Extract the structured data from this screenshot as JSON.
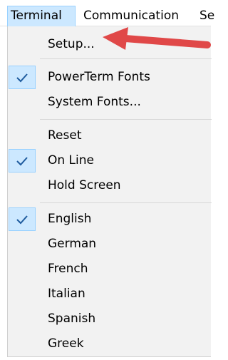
{
  "menubar": {
    "items": [
      {
        "label": "Terminal"
      },
      {
        "label": "Communication"
      },
      {
        "label": "Se"
      }
    ]
  },
  "menu": {
    "items": [
      {
        "label": "Setup...",
        "checked": false
      },
      {
        "label": "PowerTerm Fonts",
        "checked": true
      },
      {
        "label": "System Fonts...",
        "checked": false
      },
      {
        "label": "Reset",
        "checked": false
      },
      {
        "label": "On Line",
        "checked": true
      },
      {
        "label": "Hold Screen",
        "checked": false
      },
      {
        "label": "English",
        "checked": true
      },
      {
        "label": "German",
        "checked": false
      },
      {
        "label": "French",
        "checked": false
      },
      {
        "label": "Italian",
        "checked": false
      },
      {
        "label": "Spanish",
        "checked": false
      },
      {
        "label": "Greek",
        "checked": false
      }
    ]
  },
  "colors": {
    "highlight": "#cce8ff",
    "highlight_border": "#99d1ff",
    "menu_bg": "#f2f2f2",
    "arrow": "#e04848",
    "checkmark": "#1e5b9e"
  },
  "icons": {
    "check": "check-icon",
    "annotation": "red-arrow-icon"
  }
}
